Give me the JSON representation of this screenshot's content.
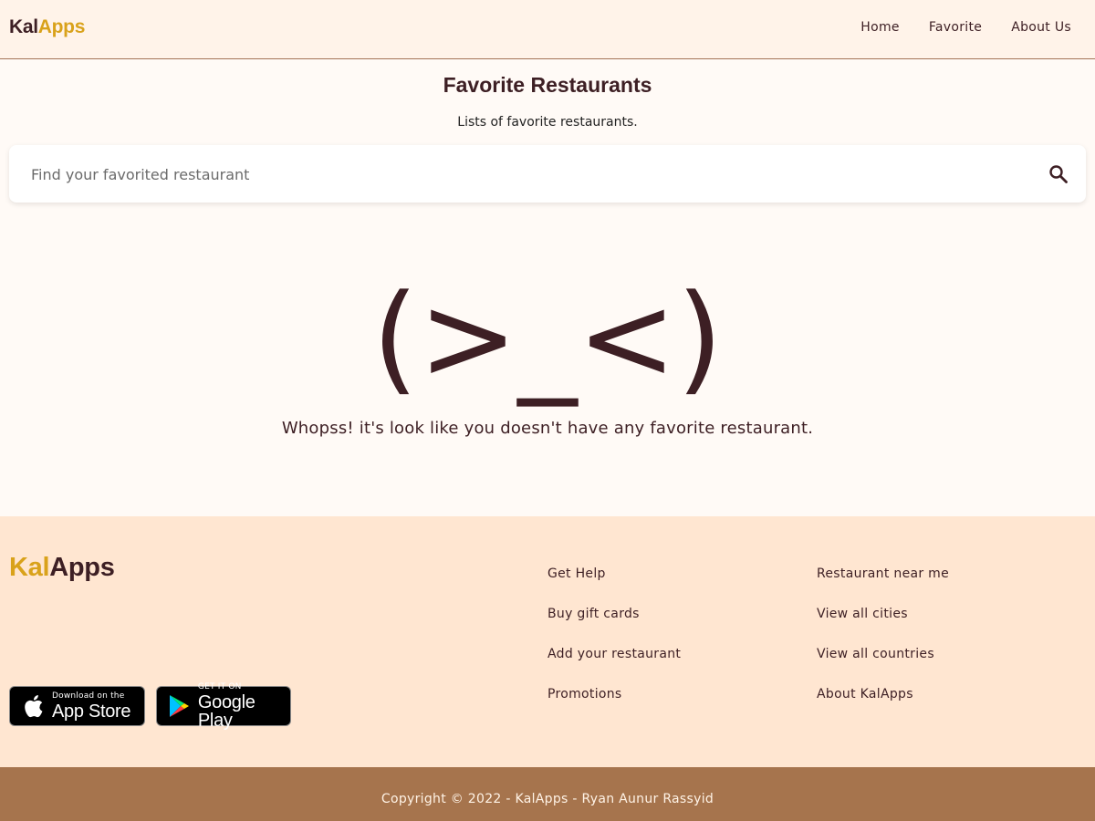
{
  "header": {
    "brand_part1": "Kal",
    "brand_part2": "Apps",
    "nav": [
      "Home",
      "Favorite",
      "About Us"
    ]
  },
  "main": {
    "title": "Favorite Restaurants",
    "subtitle": "Lists of favorite restaurants.",
    "search": {
      "placeholder": "Find your favorited restaurant",
      "value": "",
      "icon": "search-icon"
    },
    "empty_state": {
      "emoticon": "(>_<)",
      "message": "Whopss! it's look like you doesn't have any favorite restaurant."
    }
  },
  "footer": {
    "brand_part1": "Kal",
    "brand_part2": "Apps",
    "app_store": {
      "small": "Download on the",
      "big": "App Store",
      "icon": "apple-icon"
    },
    "google_play": {
      "small": "GET IT ON",
      "big": "Google Play",
      "icon": "google-play-icon"
    },
    "links_col1": [
      "Get Help",
      "Buy gift cards",
      "Add your restaurant",
      "Promotions"
    ],
    "links_col2": [
      "Restaurant near me",
      "View all cities",
      "View all countries",
      "About KalApps"
    ],
    "copyright": "Copyright © 2022 - KalApps - Ryan Aunur Rassyid"
  },
  "colors": {
    "primary": "#3d1f24",
    "accent": "#d9a21b",
    "header_bg": "#fff3e9",
    "footer_bg": "#ffe6d1",
    "copyright_bg": "#a6744d"
  }
}
